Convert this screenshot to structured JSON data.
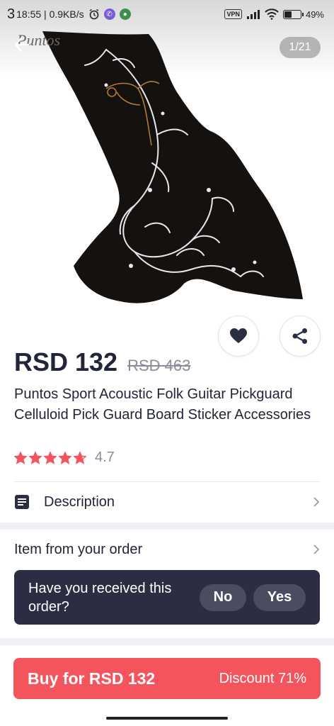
{
  "status_bar": {
    "left_digit": "3",
    "time_speed": "18:55 | 0.9KB/s",
    "vpn": "VPN",
    "battery": "49%",
    "battery_level": 0.49
  },
  "gallery": {
    "brand": "Puntos",
    "counter": "1/21"
  },
  "product": {
    "price": "RSD 132",
    "old_price": "RSD 463",
    "title": "Puntos Sport Acoustic Folk Guitar Pickguard Celluloid Pick Guard Board Sticker Accessories",
    "rating": "4.7",
    "rating_value": 4.7
  },
  "sections": {
    "description": "Description",
    "item_from_order": "Item from your order"
  },
  "order_prompt": {
    "question": "Have you received this order?",
    "no": "No",
    "yes": "Yes"
  },
  "buy": {
    "label": "Buy for RSD 132",
    "discount": "Discount 71%"
  },
  "colors": {
    "accent": "#f4555d",
    "dark": "#2b2e43",
    "text": "#22243a",
    "star": "#f4555d"
  },
  "icons": {
    "back": "arrow-left-icon",
    "favorite": "heart-icon",
    "share": "share-icon",
    "description": "document-icon",
    "chevron": "chevron-right-icon"
  }
}
